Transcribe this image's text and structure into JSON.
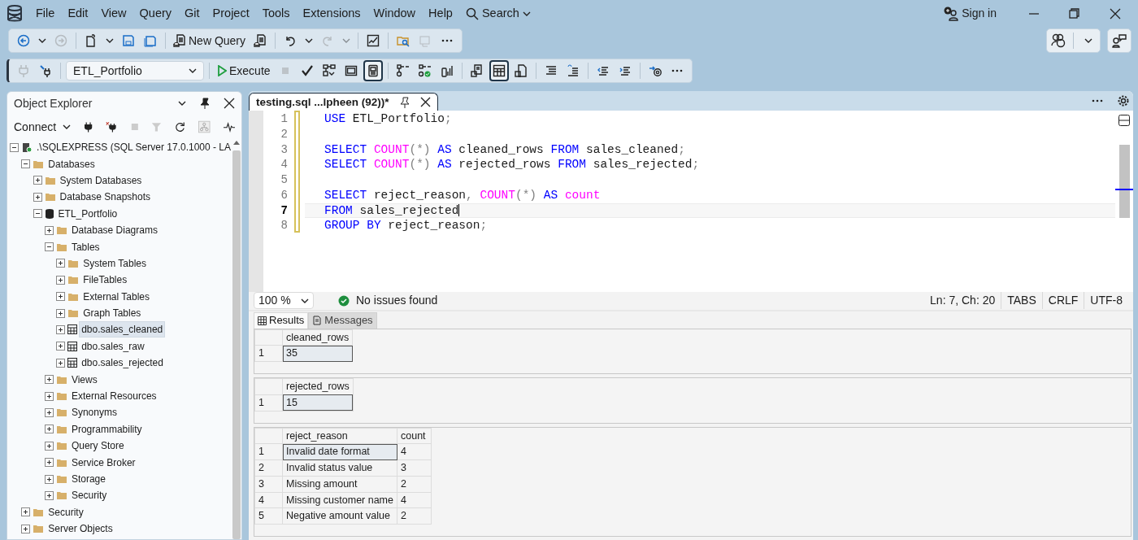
{
  "menu": {
    "items": [
      "File",
      "Edit",
      "View",
      "Query",
      "Git",
      "Project",
      "Tools",
      "Extensions",
      "Window",
      "Help"
    ],
    "search": "Search"
  },
  "sign_in": "Sign in",
  "toolbar": {
    "items": [
      {
        "kind": "icon",
        "disabled": false
      },
      {
        "kind": "caret",
        "disabled": false
      },
      {
        "kind": "icon",
        "disabled": true
      },
      {
        "kind": "separator"
      },
      {
        "kind": "icon",
        "disabled": false
      },
      {
        "kind": "caret",
        "disabled": false
      },
      {
        "kind": "icon",
        "disabled": false
      },
      {
        "kind": "icon",
        "disabled": false
      },
      {
        "kind": "separator"
      },
      {
        "kind": "button",
        "label": "New Query",
        "disabled": false
      },
      {
        "kind": "icon",
        "disabled": false
      },
      {
        "kind": "separator"
      },
      {
        "kind": "icon",
        "disabled": false
      },
      {
        "kind": "caret",
        "disabled": false
      },
      {
        "kind": "icon",
        "disabled": true
      },
      {
        "kind": "caret",
        "disabled": true
      },
      {
        "kind": "separator"
      },
      {
        "kind": "icon",
        "disabled": false
      },
      {
        "kind": "separator"
      },
      {
        "kind": "icon",
        "disabled": false
      },
      {
        "kind": "icon",
        "disabled": true
      },
      {
        "kind": "icon",
        "disabled": false
      }
    ]
  },
  "query_toolbar": {
    "items": [
      {
        "kind": "icon",
        "disabled": true,
        "pressed": false
      },
      {
        "kind": "icon",
        "disabled": false,
        "pressed": false
      },
      {
        "kind": "separator"
      },
      {
        "kind": "select",
        "value": "ETL_Portfolio"
      },
      {
        "kind": "separator"
      },
      {
        "kind": "button",
        "label": "Execute",
        "disabled": false
      },
      {
        "kind": "icon",
        "disabled": true,
        "pressed": false
      },
      {
        "kind": "icon",
        "disabled": false,
        "pressed": false
      },
      {
        "kind": "icon",
        "disabled": false,
        "pressed": false
      },
      {
        "kind": "icon",
        "disabled": false,
        "pressed": false
      },
      {
        "kind": "icon",
        "disabled": false,
        "pressed": true
      },
      {
        "kind": "separator"
      },
      {
        "kind": "icon",
        "disabled": false,
        "pressed": false
      },
      {
        "kind": "icon",
        "disabled": false,
        "pressed": false
      },
      {
        "kind": "icon",
        "disabled": false,
        "pressed": false
      },
      {
        "kind": "separator"
      },
      {
        "kind": "icon",
        "disabled": false,
        "pressed": false
      },
      {
        "kind": "icon",
        "disabled": false,
        "pressed": true
      },
      {
        "kind": "icon",
        "disabled": false,
        "pressed": false
      },
      {
        "kind": "separator"
      },
      {
        "kind": "icon",
        "disabled": false,
        "pressed": false
      },
      {
        "kind": "icon",
        "disabled": false,
        "pressed": false
      },
      {
        "kind": "separator"
      },
      {
        "kind": "icon",
        "disabled": false,
        "pressed": false
      },
      {
        "kind": "icon",
        "disabled": false,
        "pressed": false
      },
      {
        "kind": "separator"
      },
      {
        "kind": "icon",
        "disabled": false,
        "pressed": false
      },
      {
        "kind": "icon",
        "disabled": false,
        "pressed": false
      }
    ]
  },
  "object_explorer": {
    "title": "Object Explorer",
    "connect": "Connect",
    "tree": [
      {
        "label": ".\\SQLEXPRESS (SQL Server 17.0.1000 - LA",
        "kind": "server",
        "expanded": true,
        "selected": false,
        "children": [
          {
            "label": "Databases",
            "kind": "folder",
            "expanded": true,
            "selected": false,
            "children": [
              {
                "label": "System Databases",
                "kind": "folder",
                "expanded": false,
                "selected": false
              },
              {
                "label": "Database Snapshots",
                "kind": "folder",
                "expanded": false,
                "selected": false
              },
              {
                "label": "ETL_Portfolio",
                "kind": "database",
                "expanded": true,
                "selected": false,
                "children": [
                  {
                    "label": "Database Diagrams",
                    "kind": "folder",
                    "expanded": false,
                    "selected": false
                  },
                  {
                    "label": "Tables",
                    "kind": "folder",
                    "expanded": true,
                    "selected": false,
                    "children": [
                      {
                        "label": "System Tables",
                        "kind": "folder",
                        "expanded": false,
                        "selected": false
                      },
                      {
                        "label": "FileTables",
                        "kind": "folder",
                        "expanded": false,
                        "selected": false
                      },
                      {
                        "label": "External Tables",
                        "kind": "folder",
                        "expanded": false,
                        "selected": false
                      },
                      {
                        "label": "Graph Tables",
                        "kind": "folder",
                        "expanded": false,
                        "selected": false
                      },
                      {
                        "label": "dbo.sales_cleaned",
                        "kind": "table",
                        "expanded": false,
                        "selected": true
                      },
                      {
                        "label": "dbo.sales_raw",
                        "kind": "table",
                        "expanded": false,
                        "selected": false
                      },
                      {
                        "label": "dbo.sales_rejected",
                        "kind": "table",
                        "expanded": false,
                        "selected": false
                      }
                    ]
                  },
                  {
                    "label": "Views",
                    "kind": "folder",
                    "expanded": false,
                    "selected": false
                  },
                  {
                    "label": "External Resources",
                    "kind": "folder",
                    "expanded": false,
                    "selected": false
                  },
                  {
                    "label": "Synonyms",
                    "kind": "folder",
                    "expanded": false,
                    "selected": false
                  },
                  {
                    "label": "Programmability",
                    "kind": "folder",
                    "expanded": false,
                    "selected": false
                  },
                  {
                    "label": "Query Store",
                    "kind": "folder",
                    "expanded": false,
                    "selected": false
                  },
                  {
                    "label": "Service Broker",
                    "kind": "folder",
                    "expanded": false,
                    "selected": false
                  },
                  {
                    "label": "Storage",
                    "kind": "folder",
                    "expanded": false,
                    "selected": false
                  },
                  {
                    "label": "Security",
                    "kind": "folder",
                    "expanded": false,
                    "selected": false
                  }
                ]
              }
            ]
          },
          {
            "label": "Security",
            "kind": "folder",
            "expanded": false,
            "selected": false
          },
          {
            "label": "Server Objects",
            "kind": "folder",
            "expanded": false,
            "selected": false
          }
        ]
      }
    ]
  },
  "editor": {
    "tab": "testing.sql ...lpheen (92))*",
    "lines": [
      {
        "number": "1",
        "current": false,
        "tokens": [
          {
            "text": "USE",
            "kind": "keyword"
          },
          {
            "text": " ETL_Portfolio",
            "kind": "plain"
          },
          {
            "text": ";",
            "kind": "punct"
          }
        ]
      },
      {
        "number": "2",
        "current": false
      },
      {
        "number": "3",
        "current": false,
        "tokens": [
          {
            "text": "SELECT",
            "kind": "keyword"
          },
          {
            "text": " COUNT",
            "kind": "function"
          },
          {
            "text": "(*)",
            "kind": "punct"
          },
          {
            "text": " AS",
            "kind": "keyword"
          },
          {
            "text": " cleaned_rows ",
            "kind": "plain"
          },
          {
            "text": "FROM",
            "kind": "keyword"
          },
          {
            "text": " sales_cleaned",
            "kind": "plain"
          },
          {
            "text": ";",
            "kind": "punct"
          }
        ]
      },
      {
        "number": "4",
        "current": false,
        "tokens": [
          {
            "text": "SELECT",
            "kind": "keyword"
          },
          {
            "text": " COUNT",
            "kind": "function"
          },
          {
            "text": "(*)",
            "kind": "punct"
          },
          {
            "text": " AS",
            "kind": "keyword"
          },
          {
            "text": " rejected_rows ",
            "kind": "plain"
          },
          {
            "text": "FROM",
            "kind": "keyword"
          },
          {
            "text": " sales_rejected",
            "kind": "plain"
          },
          {
            "text": ";",
            "kind": "punct"
          }
        ]
      },
      {
        "number": "5",
        "current": false
      },
      {
        "number": "6",
        "current": false,
        "tokens": [
          {
            "text": "SELECT",
            "kind": "keyword"
          },
          {
            "text": " reject_reason",
            "kind": "plain"
          },
          {
            "text": ",",
            "kind": "punct"
          },
          {
            "text": " COUNT",
            "kind": "function"
          },
          {
            "text": "(*)",
            "kind": "punct"
          },
          {
            "text": " AS",
            "kind": "keyword"
          },
          {
            "text": " count",
            "kind": "function"
          }
        ]
      },
      {
        "number": "7",
        "current": true,
        "tokens": [
          {
            "text": "FROM",
            "kind": "keyword"
          },
          {
            "text": " sales_rejected",
            "kind": "plain"
          }
        ]
      },
      {
        "number": "8",
        "current": false,
        "tokens": [
          {
            "text": "GROUP BY",
            "kind": "keyword"
          },
          {
            "text": " reject_reason",
            "kind": "plain"
          },
          {
            "text": ";",
            "kind": "punct"
          }
        ]
      }
    ],
    "zoom": "100 %",
    "issues": "No issues found",
    "status": [
      "Ln: 7, Ch: 20",
      "TABS",
      "CRLF",
      "UTF-8"
    ]
  },
  "results": {
    "tabs": [
      {
        "label": "Results",
        "selected": true
      },
      {
        "label": "Messages",
        "selected": false
      }
    ],
    "grids": [
      {
        "columns": [
          "cleaned_rows"
        ],
        "rows": [
          {
            "number": "1",
            "selected": true,
            "cells": [
              "35"
            ]
          }
        ]
      },
      {
        "columns": [
          "rejected_rows"
        ],
        "rows": [
          {
            "number": "1",
            "selected": true,
            "cells": [
              "15"
            ]
          }
        ]
      },
      {
        "columns": [
          "reject_reason",
          "count"
        ],
        "rows": [
          {
            "number": "1",
            "selected": true,
            "cells": [
              "Invalid date format",
              "4"
            ]
          },
          {
            "number": "2",
            "selected": false,
            "cells": [
              "Invalid status value",
              "3"
            ]
          },
          {
            "number": "3",
            "selected": false,
            "cells": [
              "Missing amount",
              "2"
            ]
          },
          {
            "number": "4",
            "selected": false,
            "cells": [
              "Missing customer name",
              "4"
            ]
          },
          {
            "number": "5",
            "selected": false,
            "cells": [
              "Negative amount value",
              "2"
            ]
          }
        ]
      }
    ]
  }
}
